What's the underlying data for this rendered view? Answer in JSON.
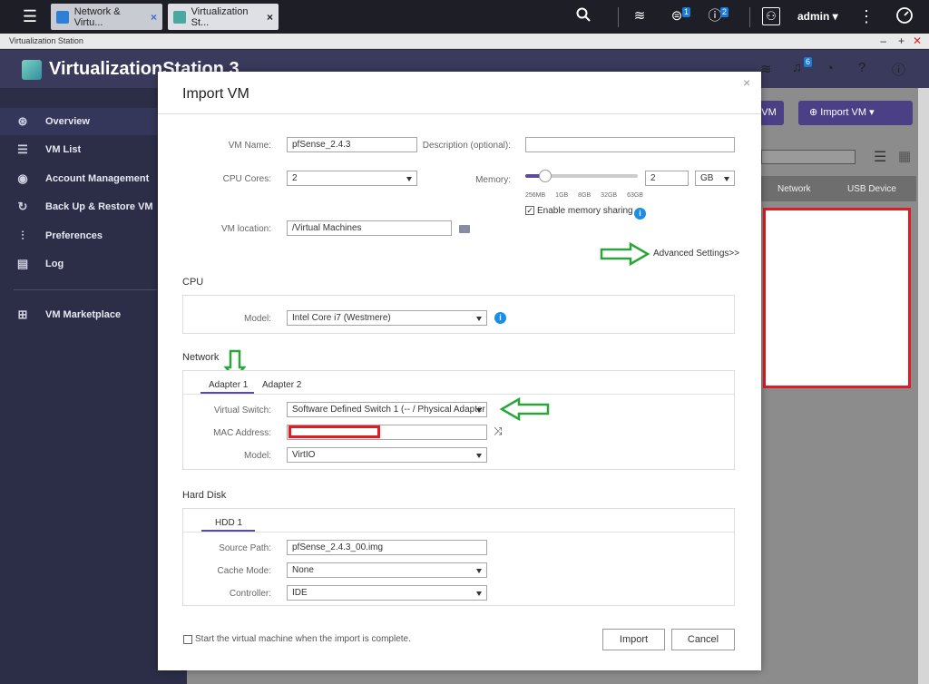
{
  "topbar": {
    "tabs": [
      {
        "label": "Network & Virtu...",
        "close": "×"
      },
      {
        "label": "Virtualization St...",
        "close": "×"
      }
    ],
    "user": "admin ▾",
    "badges": {
      "tasks": "1",
      "info": "2"
    }
  },
  "window": {
    "title": "Virtualization Station",
    "controls": [
      "–",
      "+",
      "✕"
    ]
  },
  "app": {
    "title": "VirtualizationStation 3",
    "notification_badge": "6",
    "import_vm_button": "Import VM",
    "partial_button": "VM",
    "columns": [
      "Network",
      "USB Device"
    ]
  },
  "sidebar": {
    "items": [
      {
        "label": "Overview",
        "icon": "overview-icon"
      },
      {
        "label": "VM List",
        "icon": "list-icon"
      },
      {
        "label": "Account Management",
        "icon": "account-icon"
      },
      {
        "label": "Back Up & Restore VM",
        "icon": "backup-icon"
      },
      {
        "label": "Preferences",
        "icon": "sliders-icon"
      },
      {
        "label": "Log",
        "icon": "log-icon"
      },
      {
        "label": "VM Marketplace",
        "icon": "marketplace-icon"
      }
    ]
  },
  "dialog": {
    "title": "Import VM",
    "close": "×",
    "vm_name_label": "VM Name:",
    "vm_name_value": "pfSense_2.4.3",
    "description_label": "Description (optional):",
    "description_value": "",
    "cpu_cores_label": "CPU Cores:",
    "cpu_cores_value": "2",
    "memory_label": "Memory:",
    "memory_value": "2",
    "memory_unit": "GB",
    "memory_level": 0.18,
    "memory_ticks": [
      "256MB",
      "1GB",
      "8GB",
      "32GB",
      "63GB"
    ],
    "memory_sharing_label": "Enable memory sharing",
    "memory_sharing_checked": true,
    "vm_location_label": "VM location:",
    "vm_location_value": "/Virtual Machines",
    "advanced_settings": "Advanced Settings>>",
    "cpu_section": "CPU",
    "cpu_model_label": "Model:",
    "cpu_model_value": "Intel Core i7 (Westmere)",
    "network_section": "Network",
    "adapter_tabs": [
      "Adapter 1",
      "Adapter 2"
    ],
    "virtual_switch_label": "Virtual Switch:",
    "virtual_switch_value": "Software Defined Switch 1 (-- / Physical Adapter",
    "mac_address_label": "MAC Address:",
    "mac_address_value": "",
    "net_model_label": "Model:",
    "net_model_value": "VirtIO",
    "hdd_section": "Hard Disk",
    "hdd_tab": "HDD 1",
    "source_path_label": "Source Path:",
    "source_path_value": "pfSense_2.4.3_00.img",
    "cache_mode_label": "Cache Mode:",
    "cache_mode_value": "None",
    "controller_label": "Controller:",
    "controller_value": "IDE",
    "start_vm_label": "Start the virtual machine when the import is complete.",
    "start_vm_checked": false,
    "import_button": "Import",
    "cancel_button": "Cancel"
  },
  "colors": {
    "accent": "#5b4a9e",
    "annotation_arrow": "#2aa53a",
    "highlight_box": "#e01b24",
    "info": "#1b8ee6"
  }
}
